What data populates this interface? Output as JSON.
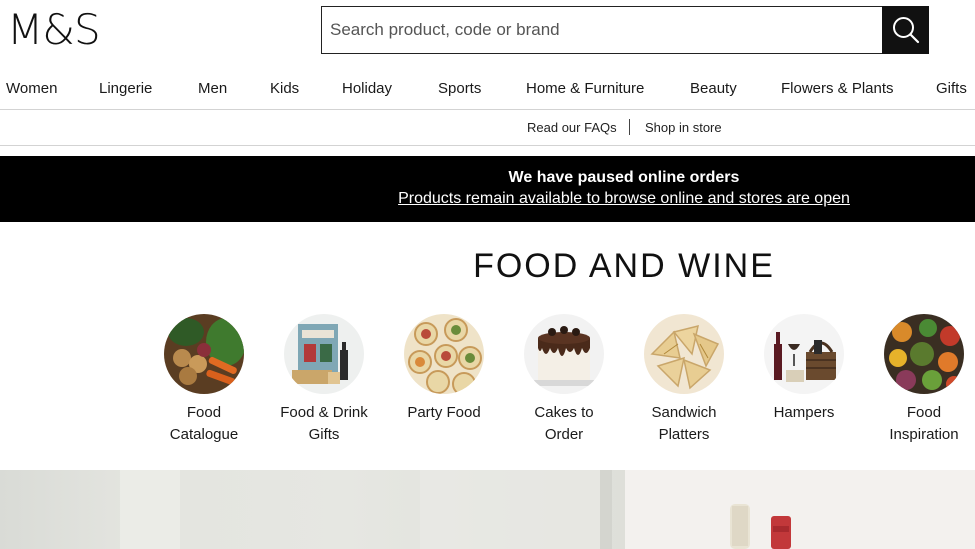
{
  "header": {
    "logo": "M&S",
    "search_placeholder": "Search product, code or brand"
  },
  "nav": {
    "items": [
      "Women",
      "Lingerie",
      "Men",
      "Kids",
      "Holiday",
      "Sports",
      "Home & Furniture",
      "Beauty",
      "Flowers & Plants",
      "Gifts"
    ]
  },
  "utility": {
    "faqs": "Read our FAQs",
    "shop_in_store": "Shop in store"
  },
  "banner": {
    "title": "We have paused online orders",
    "link": "Products remain available to browse online and stores are open"
  },
  "section": {
    "title": "FOOD AND WINE"
  },
  "categories": [
    {
      "line1": "Food",
      "line2": "Catalogue"
    },
    {
      "line1": "Food & Drink",
      "line2": "Gifts"
    },
    {
      "line1": "Party Food",
      "line2": ""
    },
    {
      "line1": "Cakes to",
      "line2": "Order"
    },
    {
      "line1": "Sandwich",
      "line2": "Platters"
    },
    {
      "line1": "Hampers",
      "line2": ""
    },
    {
      "line1": "Food",
      "line2": "Inspiration"
    }
  ],
  "colors": {
    "banner_bg": "#000000",
    "search_button": "#111111",
    "text": "#1a1a1a"
  }
}
